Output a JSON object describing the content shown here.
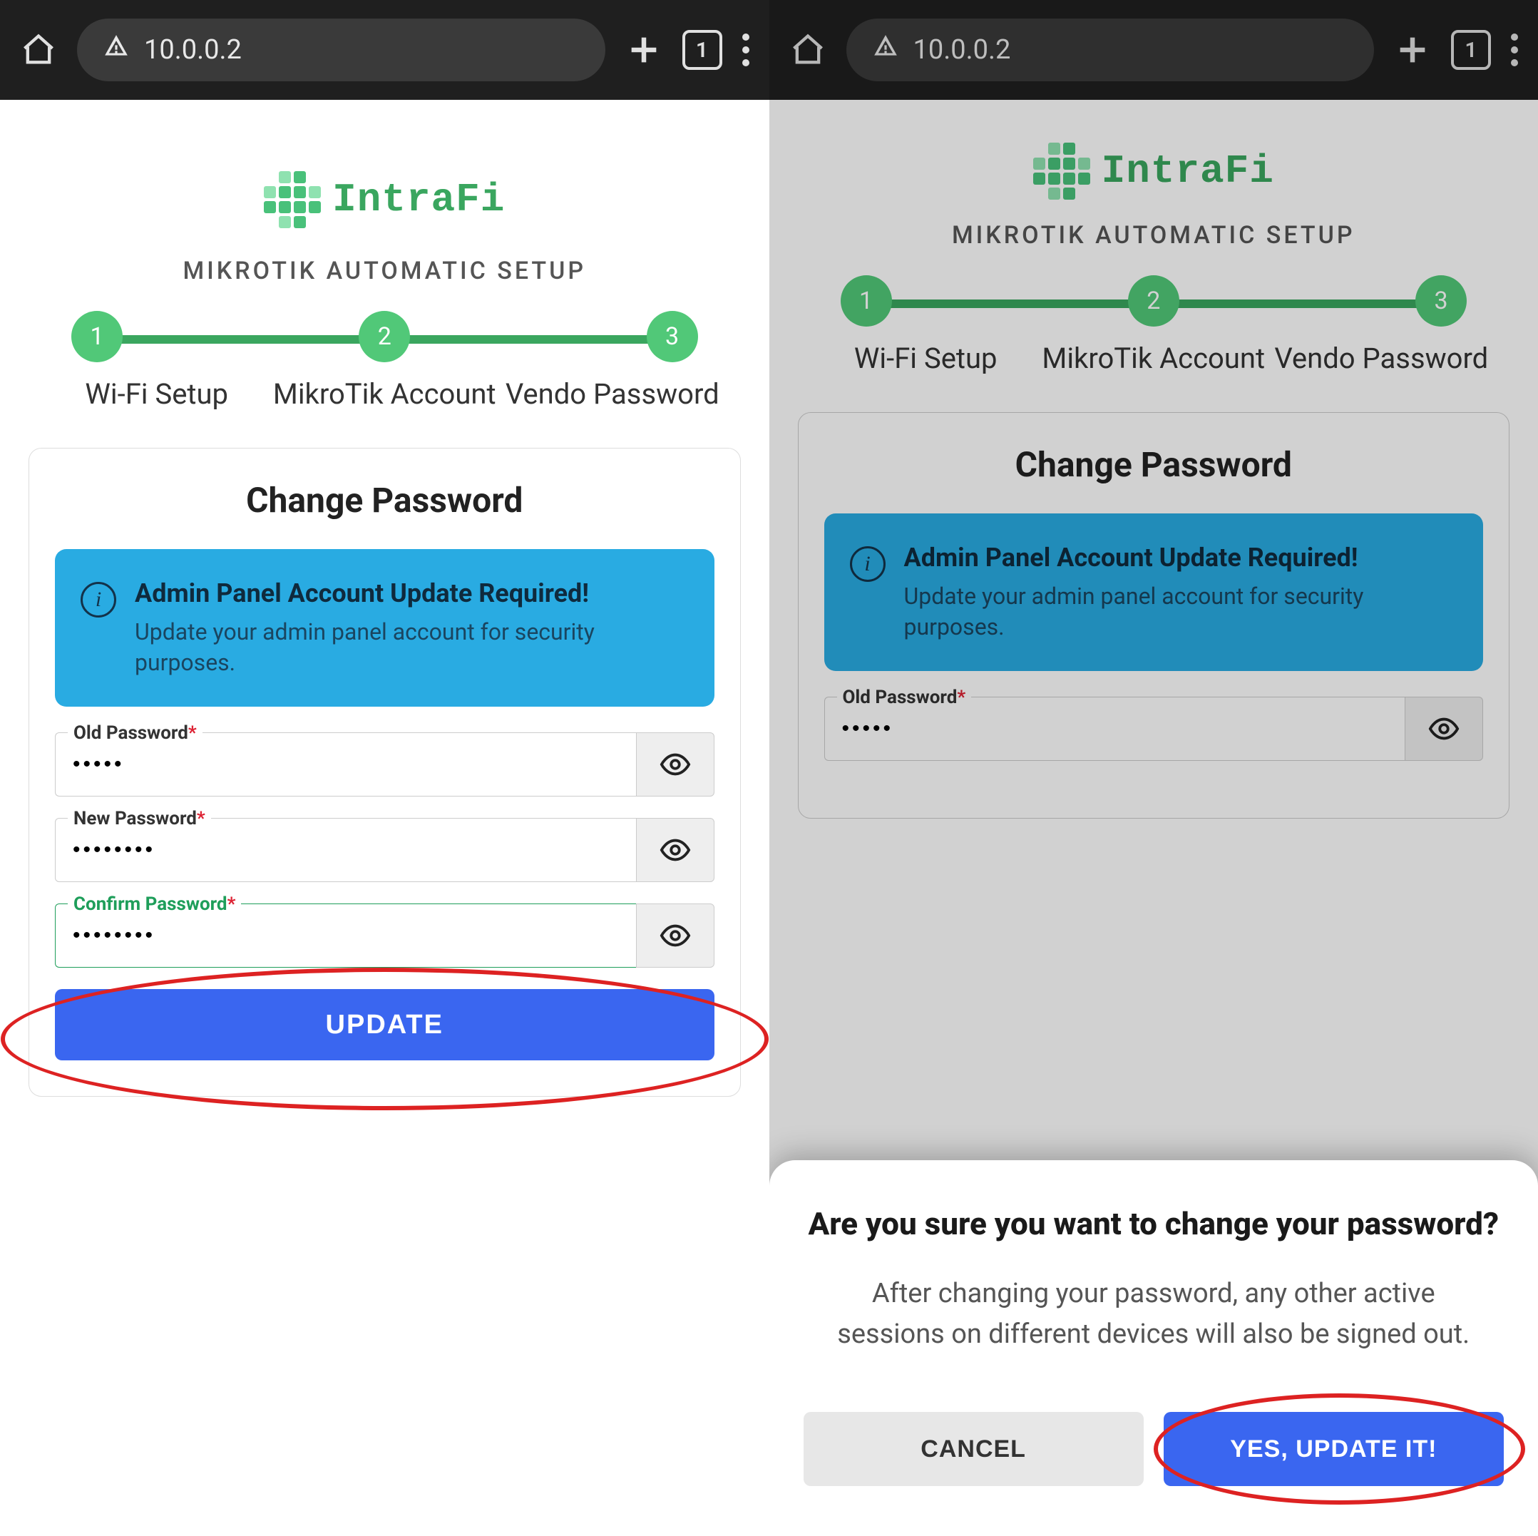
{
  "browser": {
    "url": "10.0.0.2",
    "tab_count": "1"
  },
  "brand": {
    "name": "IntraFi"
  },
  "setup_title": "MIKROTIK AUTOMATIC SETUP",
  "steps": {
    "n1": "1",
    "n2": "2",
    "n3": "3",
    "l1": "Wi-Fi Setup",
    "l2": "MikroTik Account",
    "l3": "Vendo Password"
  },
  "card": {
    "title": "Change Password",
    "alert_title": "Admin Panel Account Update Required!",
    "alert_body": "Update your admin panel account for security purposes.",
    "old_label": "Old Password",
    "new_label": "New Password",
    "confirm_label": "Confirm Password",
    "required_mark": "*",
    "old_value": "•••••",
    "new_value": "••••••••",
    "confirm_value": "••••••••",
    "update_label": "UPDATE"
  },
  "dialog": {
    "title": "Are you sure you want to change your password?",
    "body": "After changing your password, any other active sessions on different devices will also be signed out.",
    "cancel": "CANCEL",
    "confirm": "YES, UPDATE IT!"
  }
}
